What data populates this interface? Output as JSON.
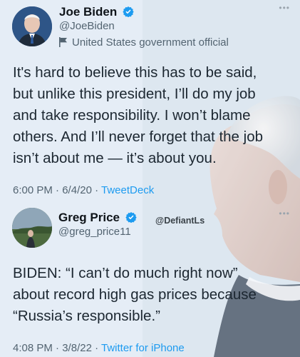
{
  "tweets": [
    {
      "name": "Joe Biden",
      "handle": "@JoeBiden",
      "account_label": "United States government official",
      "text": "It's hard to believe this has to be said,\nbut unlike this president, I’ll do my job\nand take responsibility. I won’t blame\nothers. And I’ll never forget that the job\nisn’t about me — it’s about you.",
      "time": "6:00 PM",
      "date": "6/4/20",
      "source": "TweetDeck"
    },
    {
      "name": "Greg Price",
      "handle": "@greg_price11",
      "text": "BIDEN: “I can’t do much right now”\nabout record high gas prices because\n“Russia’s responsible.”",
      "time": "4:08 PM",
      "date": "3/8/22",
      "source": "Twitter for iPhone"
    }
  ],
  "watermark": "@DefiantLs",
  "separator": " · ",
  "more_glyph": "•••",
  "colors": {
    "verified": "#1d9bf0",
    "source_link": "#1d9bf0",
    "secondary_text": "#536471"
  },
  "icons": [
    "verified-badge-icon",
    "government-flag-icon",
    "more-options-icon"
  ]
}
